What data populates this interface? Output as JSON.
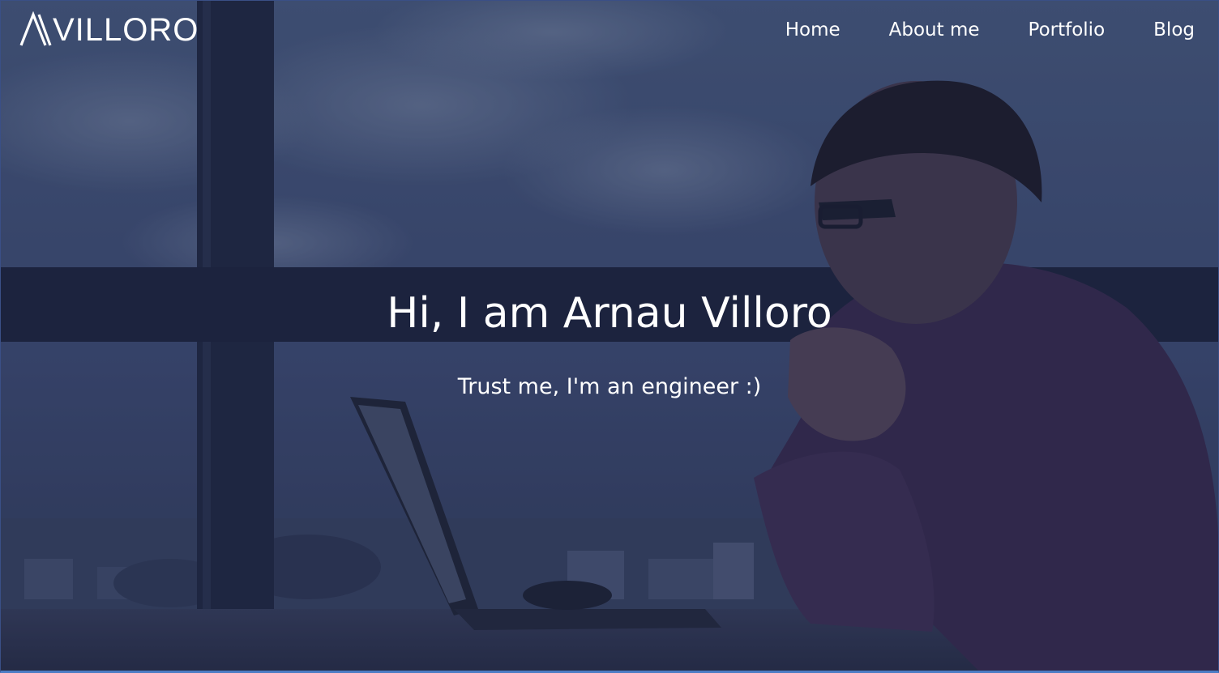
{
  "brand": {
    "logo_text": "VILLORO",
    "logo_icon": "letter-a-mark-icon"
  },
  "nav": {
    "items": [
      {
        "label": "Home"
      },
      {
        "label": "About me"
      },
      {
        "label": "Portfolio"
      },
      {
        "label": "Blog"
      }
    ]
  },
  "hero": {
    "title": "Hi, I am Arnau Villoro",
    "subtitle": "Trust me, I'm an engineer :)",
    "overlay_color": "#2b3550"
  }
}
